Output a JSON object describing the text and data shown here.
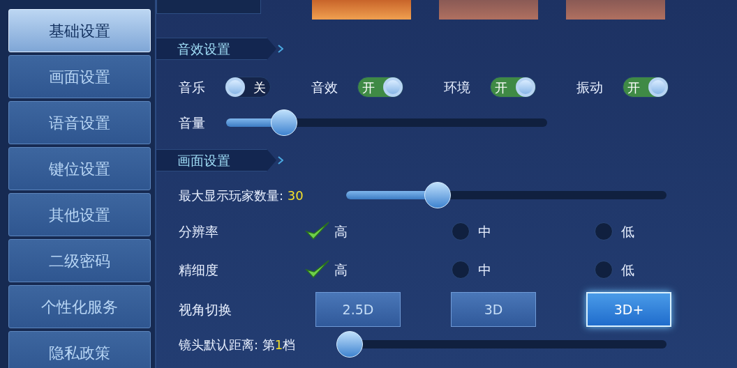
{
  "sidebar": {
    "items": [
      {
        "label": "基础设置",
        "selected": true
      },
      {
        "label": "画面设置",
        "selected": false
      },
      {
        "label": "语音设置",
        "selected": false
      },
      {
        "label": "键位设置",
        "selected": false
      },
      {
        "label": "其他设置",
        "selected": false
      },
      {
        "label": "二级密码",
        "selected": false
      },
      {
        "label": "个性化服务",
        "selected": false
      },
      {
        "label": "隐私政策",
        "selected": false
      }
    ]
  },
  "mode_buttons": [
    {
      "selected": true
    },
    {
      "selected": false
    },
    {
      "selected": false
    }
  ],
  "sound_section": {
    "title": "音效设置",
    "toggles": [
      {
        "label": "音乐",
        "on": false,
        "state_text": "关"
      },
      {
        "label": "音效",
        "on": true,
        "state_text": "开"
      },
      {
        "label": "环境",
        "on": true,
        "state_text": "开"
      },
      {
        "label": "振动",
        "on": true,
        "state_text": "开"
      }
    ],
    "volume": {
      "label": "音量",
      "level": 0.18
    }
  },
  "display_section": {
    "title": "画面设置",
    "players": {
      "label": "最大显示玩家数量: ",
      "value": "30",
      "level": 0.285
    },
    "radio_rows": [
      {
        "label": "分辨率",
        "options": [
          {
            "label": "高",
            "selected": true
          },
          {
            "label": "中",
            "selected": false
          },
          {
            "label": "低",
            "selected": false
          }
        ]
      },
      {
        "label": "精细度",
        "options": [
          {
            "label": "高",
            "selected": true
          },
          {
            "label": "中",
            "selected": false
          },
          {
            "label": "低",
            "selected": false
          }
        ]
      }
    ],
    "view": {
      "label": "视角切换",
      "options": [
        {
          "label": "2.5D",
          "selected": false
        },
        {
          "label": "3D",
          "selected": false
        },
        {
          "label": "3D+",
          "selected": true
        }
      ]
    },
    "distance": {
      "label": "镜头默认距离: 第",
      "value": "1",
      "suffix": "档",
      "level": 0.04
    }
  }
}
